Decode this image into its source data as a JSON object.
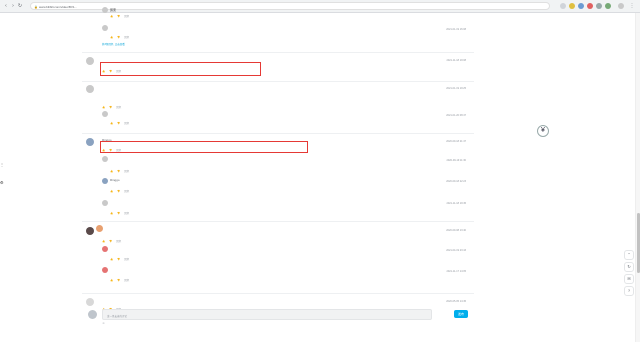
{
  "browser": {
    "url": "www.bilibili.com/video/BV1..."
  },
  "comments": [
    {
      "id": "c0",
      "replies": [
        {
          "user": "",
          "text": "厉害",
          "date": "",
          "likes": "",
          "reply": "回复"
        },
        {
          "user": "",
          "text": "",
          "date": "2021-01-19 16:08",
          "likes": "",
          "reply": "回复"
        }
      ],
      "more": "共3条回复, 点击查看"
    },
    {
      "id": "c1",
      "user": "",
      "text": "",
      "date": "2021-11-18 19:08",
      "likes": "",
      "reply": "回复"
    },
    {
      "id": "c2",
      "user": "",
      "text": "",
      "date": "2021-01-19 19:25",
      "likes": "",
      "reply": "回复",
      "sub": {
        "user": "",
        "text": "",
        "date": "2021-01-20 08:47",
        "reply": "回复"
      }
    },
    {
      "id": "c3",
      "user": "Ringgo",
      "text": "",
      "date": "2020-09-18 21:47",
      "reply": "回复",
      "subs": [
        {
          "user": "",
          "text": "",
          "date": "2020-09-19 11:30"
        },
        {
          "user": "Ringgo",
          "text": "",
          "date": "2020-09-18 22:23"
        },
        {
          "user": "",
          "text": "",
          "date": "2021-11-18 19:45"
        }
      ]
    },
    {
      "id": "c4",
      "user": "",
      "text": "",
      "date": "2020-09-08 13:40",
      "reply": "回复",
      "subs": [
        {
          "user": "",
          "text": "",
          "date": "2021-04-19 23:43"
        },
        {
          "user": "",
          "text": "",
          "date": "2021-11-17 14:05"
        }
      ]
    },
    {
      "id": "c5",
      "user": "",
      "text": "",
      "date": "2020-05-05 14:45",
      "reply": "回复"
    }
  ],
  "reply_box": {
    "placeholder": "发一条友善的评论",
    "submit": "发布"
  }
}
